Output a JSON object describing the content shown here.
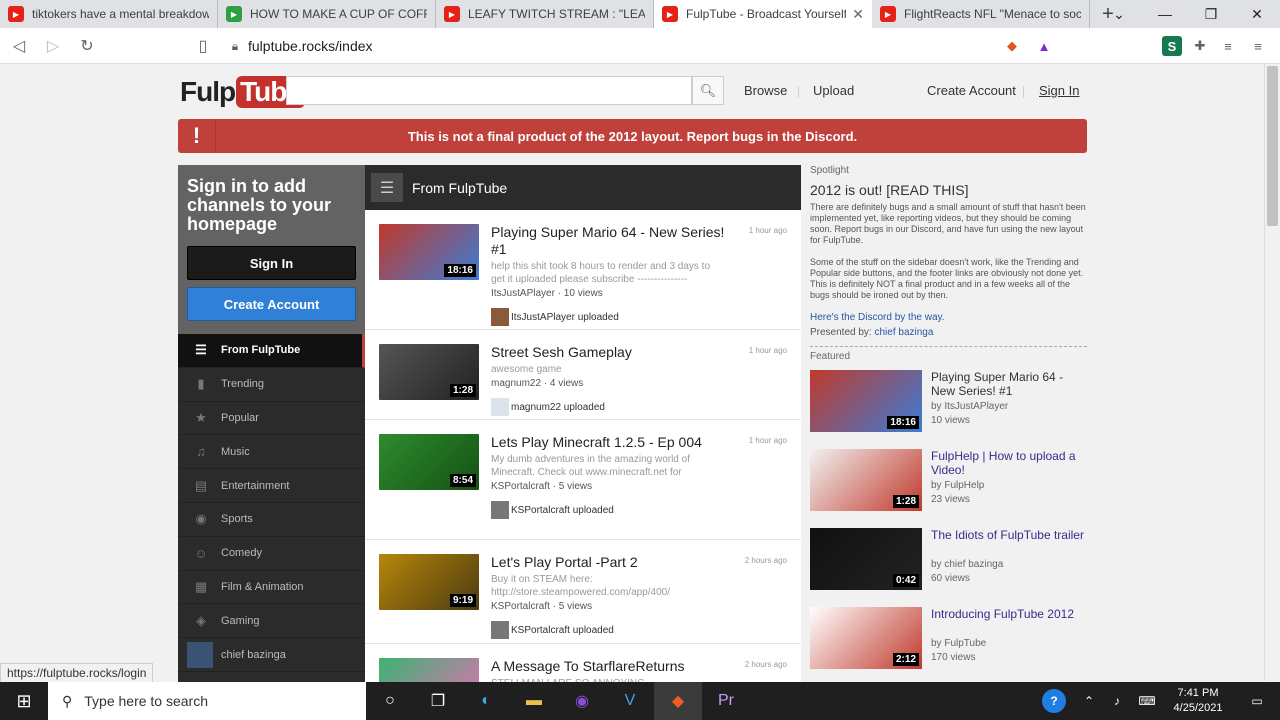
{
  "browser": {
    "tabs": [
      {
        "title": "tiktokers have a mental breakdown",
        "fav_color": "#e62117",
        "active": false
      },
      {
        "title": "HOW TO MAKE A CUP OF COFFEE W",
        "fav_color": "#2ea043",
        "active": false
      },
      {
        "title": "LEAFY TWITCH STREAM : \"LEAFY IS T",
        "fav_color": "#e62117",
        "active": false
      },
      {
        "title": "FulpTube - Broadcast Yourself.",
        "fav_color": "#e62117",
        "active": true
      },
      {
        "title": "FlightReacts NFL \"Menace to society",
        "fav_color": "#e62117",
        "active": false
      }
    ],
    "url": "fulptube.rocks/index",
    "status_url": "https://fulptube.rocks/login"
  },
  "header": {
    "logo_left": "Fulp",
    "logo_right": "Tube",
    "search_placeholder": "",
    "browse": "Browse",
    "upload": "Upload",
    "create_account": "Create Account",
    "sign_in": "Sign In"
  },
  "banner": {
    "icon": "!",
    "text": "This is not a final product of the 2012 layout. Report bugs in the Discord."
  },
  "signin_box": {
    "heading": "Sign in to add channels to your homepage",
    "sign_in_btn": "Sign In",
    "create_btn": "Create Account"
  },
  "nav": [
    {
      "label": "From FulpTube",
      "icon": "list-icon",
      "glyph": "☰",
      "active": true
    },
    {
      "label": "Trending",
      "icon": "bar-chart-icon",
      "glyph": "▮",
      "active": false
    },
    {
      "label": "Popular",
      "icon": "star-icon",
      "glyph": "★",
      "active": false
    },
    {
      "label": "Music",
      "icon": "headphones-icon",
      "glyph": "♫",
      "active": false
    },
    {
      "label": "Entertainment",
      "icon": "film-icon",
      "glyph": "▤",
      "active": false
    },
    {
      "label": "Sports",
      "icon": "ball-icon",
      "glyph": "◉",
      "active": false
    },
    {
      "label": "Comedy",
      "icon": "mask-icon",
      "glyph": "☺",
      "active": false
    },
    {
      "label": "Film & Animation",
      "icon": "clapper-icon",
      "glyph": "▦",
      "active": false
    },
    {
      "label": "Gaming",
      "icon": "gamepad-icon",
      "glyph": "◈",
      "active": false
    },
    {
      "label": "chief bazinga",
      "icon": "avatar",
      "glyph": "",
      "active": false
    }
  ],
  "feed": {
    "heading": "From FulpTube",
    "items": [
      {
        "title": "Playing Super Mario 64 - New Series! #1",
        "desc": "help this shit took 8 hours to render and 3 days to get it uploaded please subscribe ---------------",
        "meta": "ItsJustAPlayer · 10 views",
        "uploader": "ItsJustAPlayer uploaded",
        "time": "1 hour ago",
        "duration": "18:16",
        "thumb": "#c0392b",
        "thumb2": "#3b7dd8",
        "avatar": "#8a5a3b"
      },
      {
        "title": "Street Sesh Gameplay",
        "desc": "awesome game",
        "meta": "magnum22 · 4 views",
        "uploader": "magnum22 uploaded",
        "time": "1 hour ago",
        "duration": "1:28",
        "thumb": "#555555",
        "thumb2": "#222222",
        "avatar": "#dde3ec"
      },
      {
        "title": "Lets Play Minecraft 1.2.5 - Ep 004",
        "desc": "My dumb adventures in the amazing world of Minecraft. Check out www.minecraft.net for",
        "meta": "KSPortalcraft · 5 views",
        "uploader": "KSPortalcraft uploaded",
        "time": "1 hour ago",
        "duration": "8:54",
        "thumb": "#2e8b2e",
        "thumb2": "#145214",
        "avatar": "#777777"
      },
      {
        "title": "Let's Play Portal -Part 2",
        "desc": "Buy it on STEAM here: http://store.steampowered.com/app/400/",
        "meta": "KSPortalcraft · 5 views",
        "uploader": "KSPortalcraft uploaded",
        "time": "2 hours ago",
        "duration": "9:19",
        "thumb": "#b8860b",
        "thumb2": "#4a3b10",
        "avatar": "#777777"
      },
      {
        "title": "A Message To StarflareReturns",
        "desc": "STELLMAN I ARE SO ANNOYING",
        "meta": "",
        "uploader": "",
        "time": "2 hours ago",
        "duration": "",
        "thumb": "#3cb371",
        "thumb2": "#e36fb5",
        "avatar": "#777777"
      }
    ]
  },
  "spotlight": {
    "label": "Spotlight",
    "title": "2012 is out! [READ THIS]",
    "para1": "There are definitely bugs and a small amount of stuff that hasn't been implemented yet, like reporting videos, but they should be coming soon. Report bugs in our Discord, and have fun using the new layout for FulpTube.",
    "para2": "Some of the stuff on the sidebar doesn't work, like the Trending and Popular side buttons, and the footer links are obviously not done yet. This is definitely NOT a final product and in a few weeks all of the bugs should be ironed out by then.",
    "discord_link": "Here's the Discord by the way.",
    "presented_prefix": "Presented by:",
    "presented_by": "chief bazinga"
  },
  "featured": {
    "label": "Featured",
    "items": [
      {
        "title": "Playing Super Mario 64 - New Series! #1",
        "by": "by ItsJustAPlayer",
        "views": "10 views",
        "duration": "18:16",
        "thumb": "#c0392b",
        "thumb2": "#3b7dd8",
        "link": false
      },
      {
        "title": "FulpHelp | How to upload a Video!",
        "by": "by FulpHelp",
        "views": "23 views",
        "duration": "1:28",
        "thumb": "#f2f2f2",
        "thumb2": "#c0392b",
        "link": true
      },
      {
        "title": "The Idiots of FulpTube trailer",
        "by": "by chief bazinga",
        "views": "60 views",
        "duration": "0:42",
        "thumb": "#111111",
        "thumb2": "#222222",
        "link": true
      },
      {
        "title": "Introducing FulpTube 2012",
        "by": "by FulpTube",
        "views": "170 views",
        "duration": "2:12",
        "thumb": "#ffffff",
        "thumb2": "#c0392b",
        "link": true
      }
    ]
  },
  "taskbar": {
    "search_placeholder": "Type here to search",
    "time": "7:41 PM",
    "date": "4/25/2021"
  }
}
